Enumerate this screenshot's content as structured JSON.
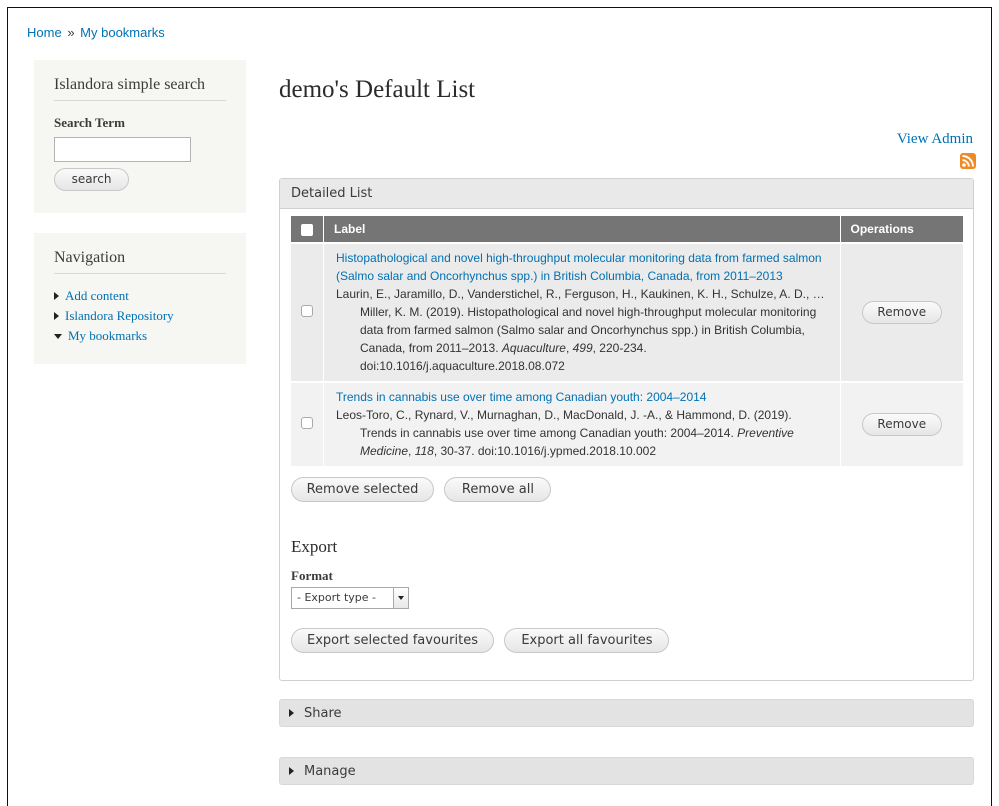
{
  "breadcrumb": {
    "home": "Home",
    "separator": "»",
    "current": "My bookmarks"
  },
  "sidebar": {
    "search": {
      "title": "Islandora simple search",
      "label": "Search Term",
      "value": "",
      "button": "search"
    },
    "navigation": {
      "title": "Navigation",
      "items": [
        {
          "label": "Add content",
          "expanded": false
        },
        {
          "label": "Islandora Repository",
          "expanded": false
        },
        {
          "label": "My bookmarks",
          "expanded": true
        }
      ]
    }
  },
  "main": {
    "title": "demo's Default List",
    "view_admin": "View Admin",
    "rss_icon": "rss-feed-icon",
    "detailed_list": {
      "legend": "Detailed List",
      "columns": {
        "label": "Label",
        "operations": "Operations"
      },
      "rows": [
        {
          "title": "Histopathological and novel high-throughput molecular monitoring data from farmed salmon (Salmo salar and Oncorhynchus spp.) in British Columbia, Canada, from 2011–2013",
          "citation_pre": "Laurin, E., Jaramillo, D., Vanderstichel, R., Ferguson, H., Kaukinen, K. H., Schulze, A. D., … Miller, K. M. (2019). Histopathological and novel high-throughput molecular monitoring data from farmed salmon (Salmo salar and Oncorhynchus spp.) in British Columbia, Canada, from 2011–2013. ",
          "journal": "Aquaculture",
          "sep1": ", ",
          "volume": "499",
          "citation_post": ", 220-234. doi:10.1016/j.aquaculture.2018.08.072",
          "remove": "Remove"
        },
        {
          "title": "Trends in cannabis use over time among Canadian youth: 2004–2014",
          "citation_pre": "Leos-Toro, C., Rynard, V., Murnaghan, D., MacDonald, J. -A., & Hammond, D. (2019). Trends in cannabis use over time among Canadian youth: 2004–2014. ",
          "journal": "Preventive Medicine",
          "sep1": ", ",
          "volume": "118",
          "citation_post": ", 30-37. doi:10.1016/j.ypmed.2018.10.002",
          "remove": "Remove"
        }
      ],
      "remove_selected": "Remove selected",
      "remove_all": "Remove all"
    },
    "export": {
      "title": "Export",
      "format_label": "Format",
      "format_selected": "- Export type -",
      "export_selected": "Export selected favourites",
      "export_all": "Export all favourites"
    },
    "share": "Share",
    "manage": "Manage"
  }
}
